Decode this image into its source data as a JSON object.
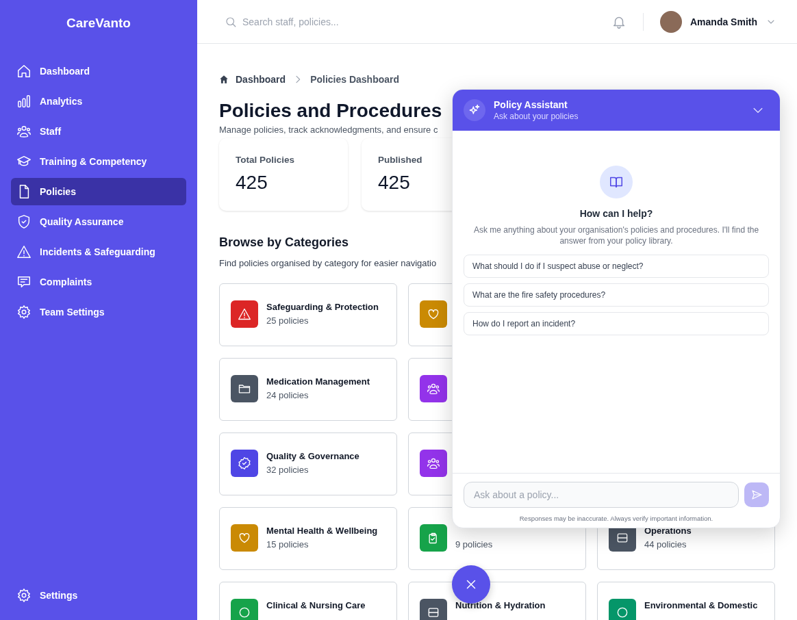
{
  "sidebar": {
    "logo": "CareVanto",
    "items": [
      {
        "label": "Dashboard",
        "selected": false
      },
      {
        "label": "Analytics",
        "selected": false
      },
      {
        "label": "Staff",
        "selected": false
      },
      {
        "label": "Training & Competency",
        "selected": false
      },
      {
        "label": "Policies",
        "selected": true
      },
      {
        "label": "Quality Assurance",
        "selected": false
      },
      {
        "label": "Incidents & Safeguarding",
        "selected": false
      },
      {
        "label": "Complaints",
        "selected": false
      },
      {
        "label": "Team Settings",
        "selected": false
      }
    ],
    "footer_item": {
      "label": "Settings",
      "selected": false
    }
  },
  "topbar": {
    "search": {
      "placeholder": "Search staff, policies..."
    },
    "user": {
      "name": "Amanda Smith"
    }
  },
  "breadcrumb": [
    "Dashboard",
    "Policies Dashboard"
  ],
  "page": {
    "title": "Policies and Procedures",
    "subtitle": "Manage policies, track acknowledgments, and ensure c"
  },
  "stats": [
    {
      "label": "Total Policies",
      "value": "425"
    },
    {
      "label": "Published",
      "value": "425"
    }
  ],
  "categories": {
    "title": "Browse by Categories",
    "subtitle": "Find policies organised by category for easier navigatio",
    "rows": [
      [
        {
          "title": "Safeguarding & Protection",
          "count": "25 policies",
          "color": "#dc2626"
        },
        {
          "color": "#ca8a04"
        }
      ],
      [
        {
          "title": "Medication Management",
          "count": "24 policies",
          "color": "#4b5563"
        },
        {
          "color": "#9333ea"
        }
      ],
      [
        {
          "title": "Quality & Governance",
          "count": "32 policies",
          "color": "#4f46e5"
        },
        {
          "color": "#9333ea"
        }
      ],
      [
        {
          "title": "Mental Health & Wellbeing",
          "count": "15 policies",
          "color": "#ca8a04"
        },
        {
          "count": "9 policies",
          "color": "#16a34a"
        },
        {
          "title": "Operations",
          "count": "44 policies",
          "color": "#4b5563"
        }
      ],
      [
        {
          "title": "Clinical & Nursing Care",
          "color": "#16a34a"
        },
        {
          "title": "Nutrition & Hydration",
          "color": "#4b5563"
        },
        {
          "title": "Environmental & Domestic",
          "color": "#059669"
        }
      ]
    ]
  },
  "assistant": {
    "title": "Policy Assistant",
    "subtitle": "Ask about your policies",
    "heading": "How can I help?",
    "intro": "Ask me anything about your organisation's policies and procedures. I'll find the answer from your policy library.",
    "suggestions": [
      "What should I do if I suspect abuse or neglect?",
      "What are the fire safety procedures?",
      "How do I report an incident?"
    ],
    "input": {
      "placeholder": "Ask about a policy..."
    },
    "send": {
      "disabled": true
    },
    "disclaimer": "Responses may be inaccurate. Always verify important information."
  }
}
